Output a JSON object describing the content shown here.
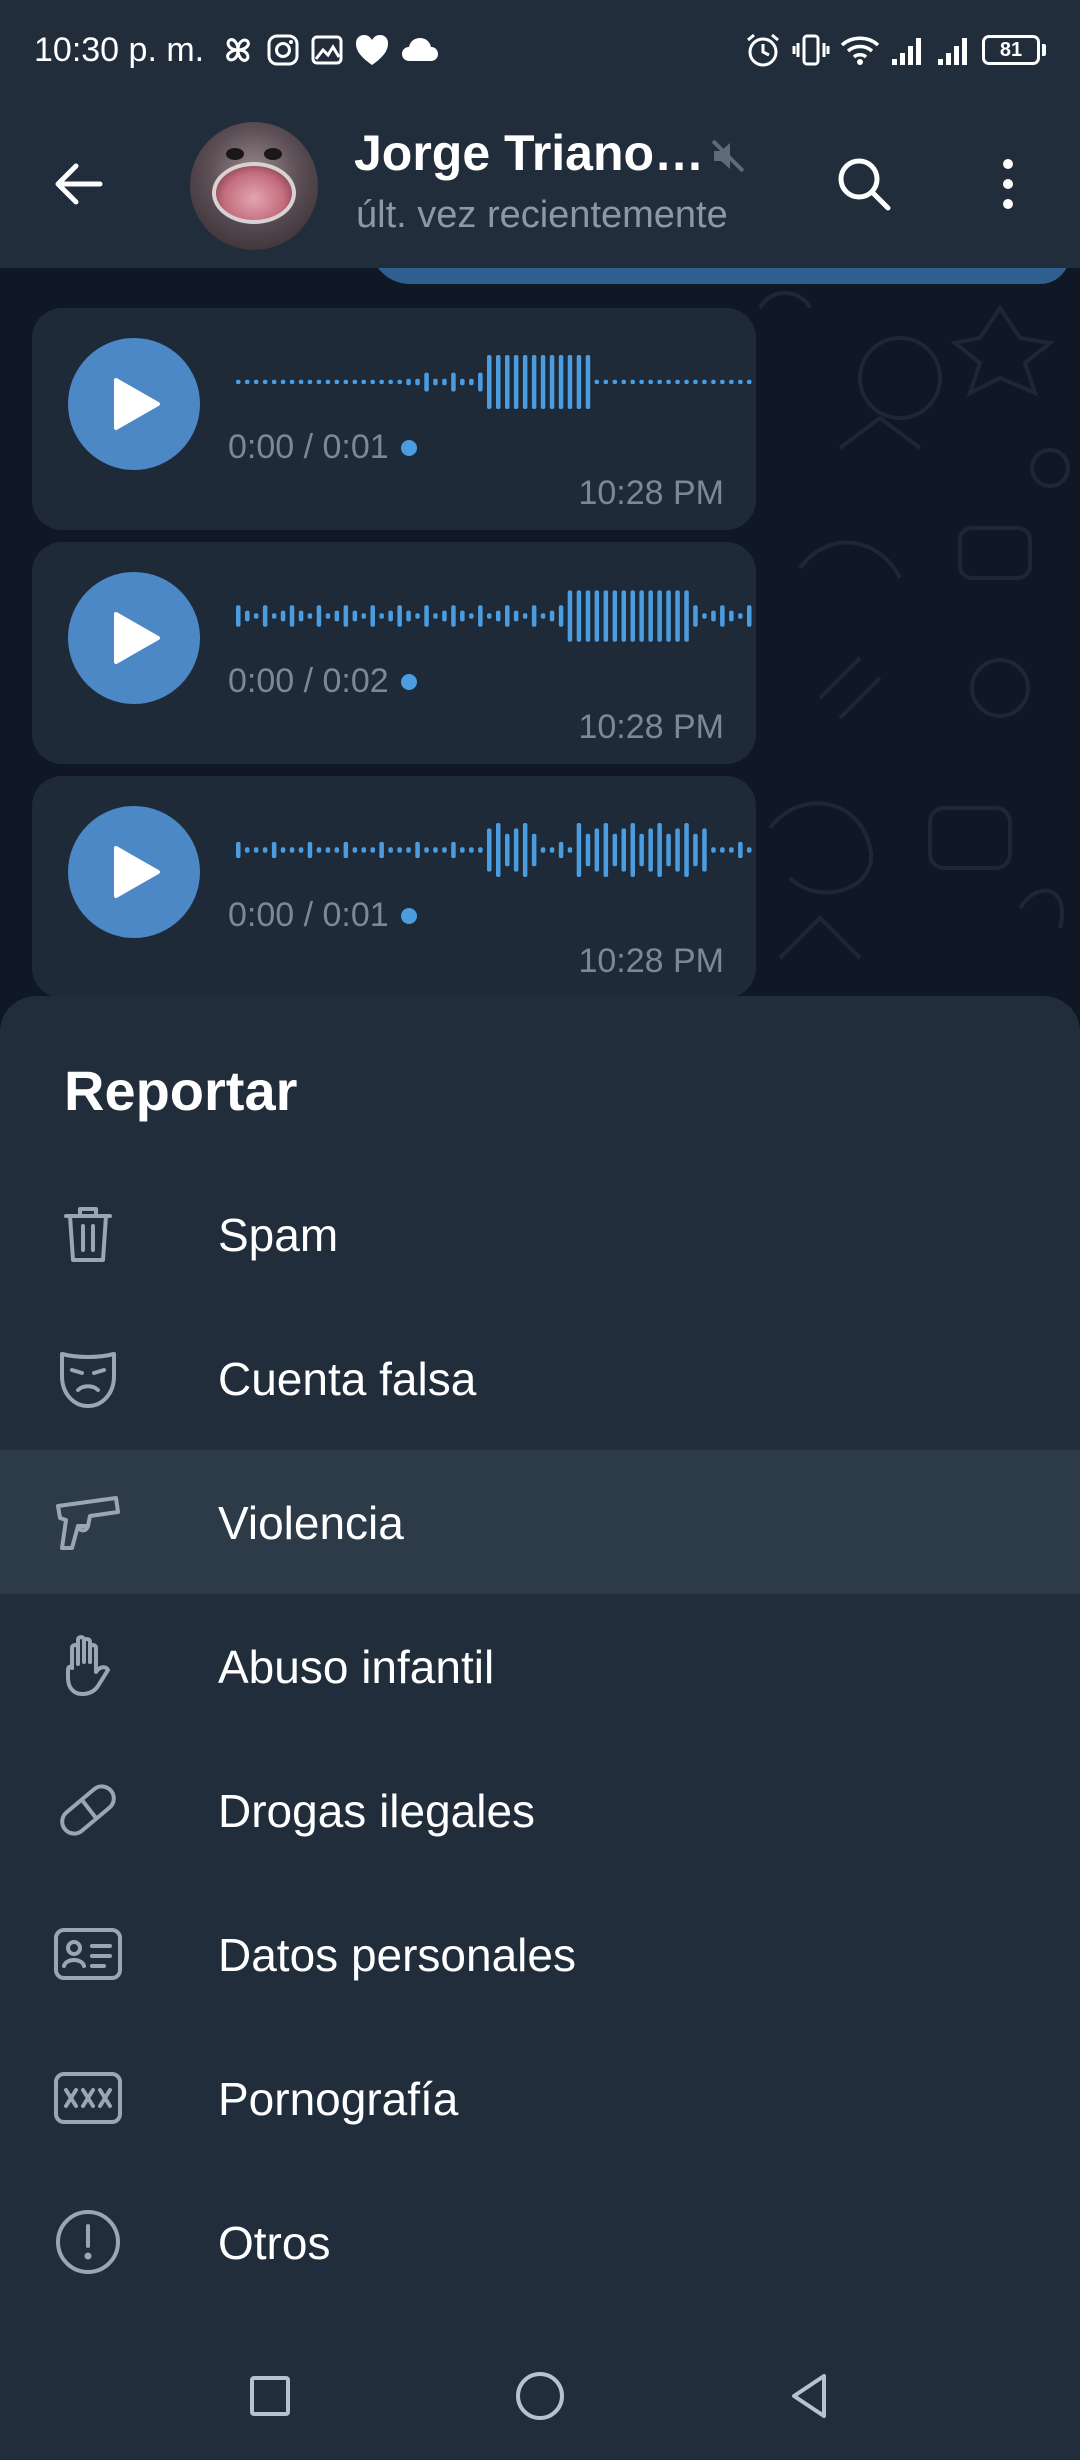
{
  "status_bar": {
    "time": "10:30 p. m.",
    "battery": "81"
  },
  "header": {
    "contact_name": "Jorge Triano…",
    "last_seen": "últ. vez recientemente"
  },
  "messages": [
    {
      "duration": "0:00 / 0:01",
      "time": "10:28 PM"
    },
    {
      "duration": "0:00 / 0:02",
      "time": "10:28 PM"
    },
    {
      "duration": "0:00 / 0:01",
      "time": "10:28 PM"
    }
  ],
  "report_sheet": {
    "title": "Reportar",
    "options": [
      {
        "label": "Spam",
        "icon": "trash-icon"
      },
      {
        "label": "Cuenta falsa",
        "icon": "sad-mask-icon"
      },
      {
        "label": "Violencia",
        "icon": "gun-icon"
      },
      {
        "label": "Abuso infantil",
        "icon": "hand-icon"
      },
      {
        "label": "Drogas ilegales",
        "icon": "pill-icon"
      },
      {
        "label": "Datos personales",
        "icon": "id-card-icon"
      },
      {
        "label": "Pornografía",
        "icon": "xxx-icon"
      },
      {
        "label": "Otros",
        "icon": "exclamation-icon"
      }
    ],
    "highlighted_index": 2
  },
  "colors": {
    "header_bg": "#212d3b",
    "chat_bg": "#0f1824",
    "bubble_bg": "#1e2a38",
    "accent": "#4c88c6",
    "sheet_bg": "#212d3b",
    "highlight_bg": "#2d3a48"
  }
}
